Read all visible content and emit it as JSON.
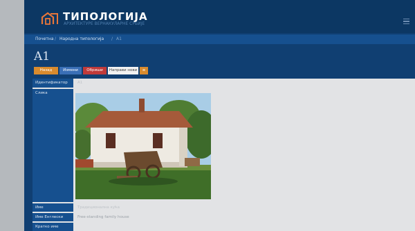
{
  "header": {
    "brand": "ТИПОЛОГИЈА",
    "brand_subtitle": "АРХИТЕКТУРЕ ВЕРНАКУЛАРНЕ СРБИЈЕ"
  },
  "breadcrumb": {
    "items": [
      "Почетна",
      "Народна типологија",
      "А1"
    ],
    "separator": "/"
  },
  "page": {
    "title": "A1"
  },
  "actions": {
    "back": "Назад",
    "edit": "Измени",
    "delete": "Обриши",
    "new": "Направи нови",
    "extra": "≡"
  },
  "details": {
    "identifier_label": "Идентификатор",
    "identifier_value": "A1",
    "image_label": "Слика",
    "name_label": "Име",
    "name_value": "Традиционална кућа",
    "name_en_label": "Име Енглески",
    "name_en_value": "Free-standing family house",
    "short_name_label": "Кратко име"
  },
  "colors": {
    "app_bg": "#103f72",
    "header_bg": "#0c3763",
    "breadcrumb_bg": "#16508f",
    "btn_back": "#d98b2e",
    "btn_edit": "#3a6fb6",
    "btn_delete": "#c03a3a"
  }
}
